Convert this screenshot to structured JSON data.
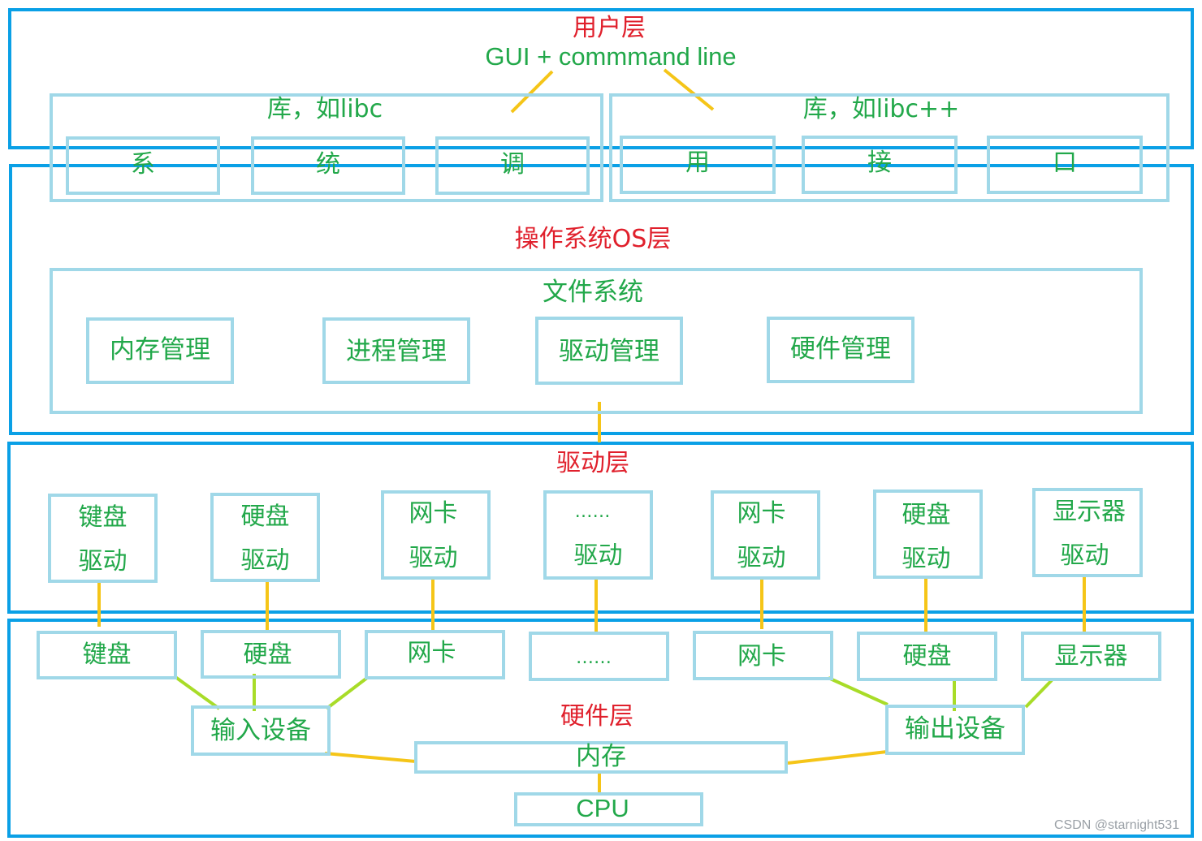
{
  "colors": {
    "layer_border": "#0aa0e6",
    "box_border": "#a0d8e8",
    "label_green": "#22a84a",
    "title_red": "#e0202c",
    "connector_yellow": "#f5c518",
    "connector_lime": "#a8dc28"
  },
  "user_layer": {
    "title": "用户层",
    "subtitle": "GUI + commmand line",
    "lib_left": {
      "label": "库，如libc",
      "items": [
        "系",
        "统",
        "调"
      ]
    },
    "lib_right": {
      "label": "库，如libc++",
      "items": [
        "用",
        "接",
        "口"
      ]
    }
  },
  "os_layer": {
    "title": "操作系统OS层",
    "filesystem": {
      "label": "文件系统",
      "modules": [
        "内存管理",
        "进程管理",
        "驱动管理",
        "硬件管理"
      ]
    }
  },
  "driver_layer": {
    "title": "驱动层",
    "drivers": [
      {
        "line1": "键盘",
        "line2": "驱动"
      },
      {
        "line1": "硬盘",
        "line2": "驱动"
      },
      {
        "line1": "网卡",
        "line2": "驱动"
      },
      {
        "line1": "……",
        "line2": "驱动"
      },
      {
        "line1": "网卡",
        "line2": "驱动"
      },
      {
        "line1": "硬盘",
        "line2": "驱动"
      },
      {
        "line1": "显示器",
        "line2": "驱动"
      }
    ]
  },
  "hardware_layer": {
    "title": "硬件层",
    "devices": [
      "键盘",
      "硬盘",
      "网卡",
      "……",
      "网卡",
      "硬盘",
      "显示器"
    ],
    "input_device": "输入设备",
    "output_device": "输出设备",
    "memory": "内存",
    "cpu": "CPU"
  },
  "watermark": "CSDN @starnight531"
}
